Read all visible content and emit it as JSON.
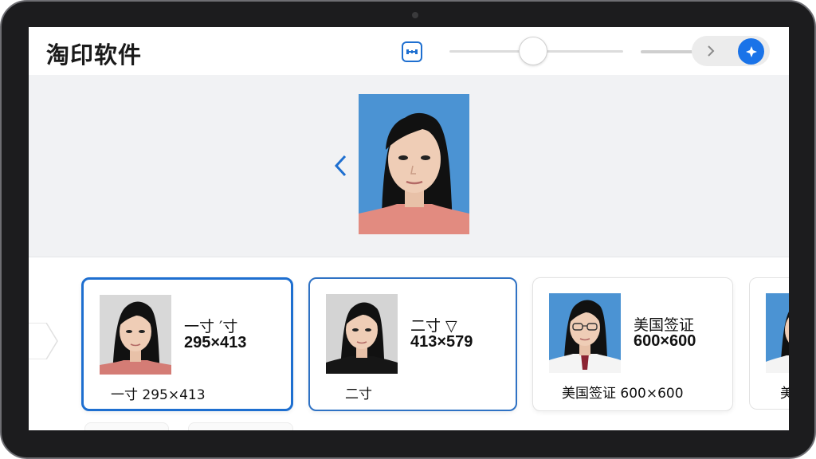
{
  "app": {
    "title": "淘印软件"
  },
  "toolbar": {
    "crop_icon": "crop-adjust-icon",
    "next_icon": "chevron-right-icon",
    "action_icon": "sparkle-icon",
    "slider_value": 0.48,
    "accent_color": "#1a73e8"
  },
  "preview": {
    "prev_icon": "chevron-left-icon",
    "background_color": "#4b93d3"
  },
  "cards": [
    {
      "name": "一寸 ′寸",
      "dims": "295×413",
      "caption": "一寸 295×413",
      "selected": true
    },
    {
      "name": "二寸 ▽",
      "dims": "413×579",
      "caption": "二寸",
      "selected": false
    },
    {
      "name": "美国签证",
      "dims": "600×600",
      "caption": "美国签证 600×600",
      "selected": false
    },
    {
      "caption": "美"
    }
  ]
}
